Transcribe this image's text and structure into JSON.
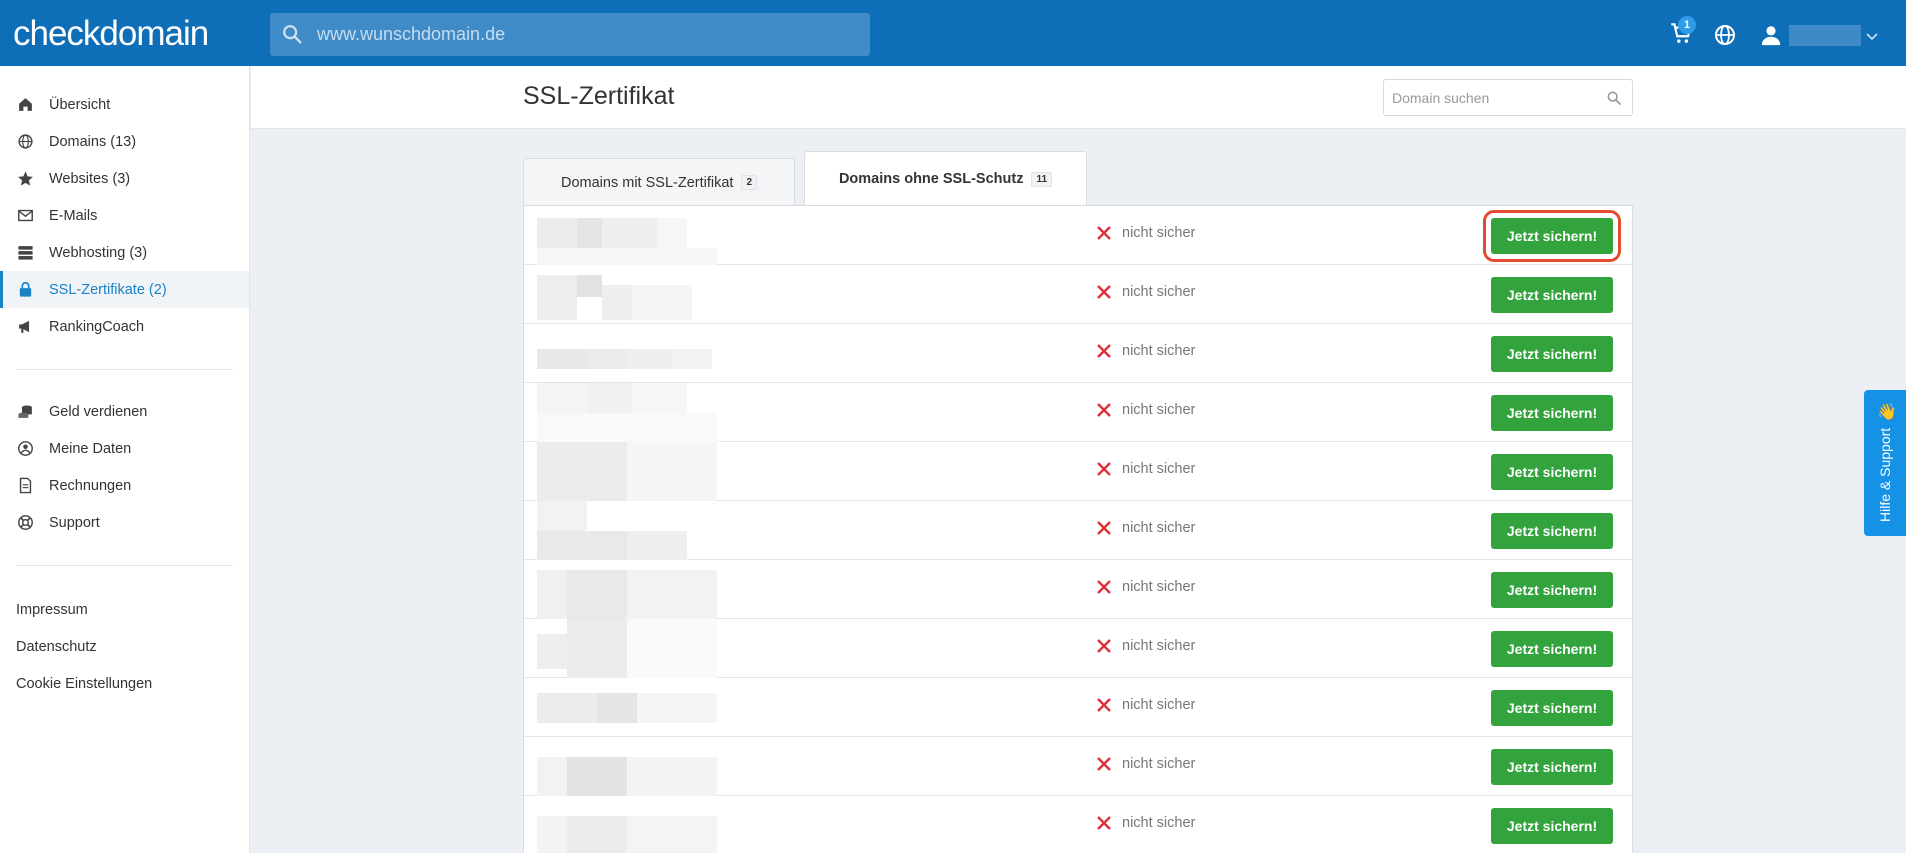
{
  "brand": {
    "logo_text": "checkdomain"
  },
  "topbar": {
    "search_placeholder": "www.wunschdomain.de",
    "cart_count": "1"
  },
  "sidebar": {
    "items": [
      {
        "label": "Übersicht",
        "icon": "home-icon"
      },
      {
        "label": "Domains (13)",
        "icon": "globe-icon"
      },
      {
        "label": "Websites (3)",
        "icon": "star-icon"
      },
      {
        "label": "E-Mails",
        "icon": "mail-icon"
      },
      {
        "label": "Webhosting (3)",
        "icon": "server-icon"
      },
      {
        "label": "SSL-Zertifikate (2)",
        "icon": "lock-icon",
        "active": true
      },
      {
        "label": "RankingCoach",
        "icon": "megaphone-icon"
      }
    ],
    "account_items": [
      {
        "label": "Geld verdienen",
        "icon": "coins-icon"
      },
      {
        "label": "Meine Daten",
        "icon": "user-circle-icon"
      },
      {
        "label": "Rechnungen",
        "icon": "document-icon"
      },
      {
        "label": "Support",
        "icon": "lifebuoy-icon"
      }
    ],
    "footer_links": [
      "Impressum",
      "Datenschutz",
      "Cookie Einstellungen"
    ]
  },
  "page": {
    "title": "SSL-Zertifikat",
    "domain_search_placeholder": "Domain suchen"
  },
  "tabs": [
    {
      "label": "Domains mit SSL-Zertifikat",
      "count": "2",
      "active": false
    },
    {
      "label": "Domains ohne SSL-Schutz",
      "count": "11",
      "active": true
    }
  ],
  "rows": [
    {
      "status": "nicht sicher",
      "action": "Jetzt sichern!",
      "highlighted": true
    },
    {
      "status": "nicht sicher",
      "action": "Jetzt sichern!"
    },
    {
      "status": "nicht sicher",
      "action": "Jetzt sichern!"
    },
    {
      "status": "nicht sicher",
      "action": "Jetzt sichern!"
    },
    {
      "status": "nicht sicher",
      "action": "Jetzt sichern!"
    },
    {
      "status": "nicht sicher",
      "action": "Jetzt sichern!"
    },
    {
      "status": "nicht sicher",
      "action": "Jetzt sichern!"
    },
    {
      "status": "nicht sicher",
      "action": "Jetzt sichern!"
    },
    {
      "status": "nicht sicher",
      "action": "Jetzt sichern!"
    },
    {
      "status": "nicht sicher",
      "action": "Jetzt sichern!"
    },
    {
      "status": "nicht sicher",
      "action": "Jetzt sichern!"
    }
  ],
  "help": {
    "label": "Hilfe & Support",
    "icon": "waving-hand-icon"
  },
  "colors": {
    "topbar": "#0e6eb7",
    "accent": "#1a83c8",
    "button": "#33a33d",
    "danger": "#e0303a",
    "highlight": "#e24b2f"
  }
}
